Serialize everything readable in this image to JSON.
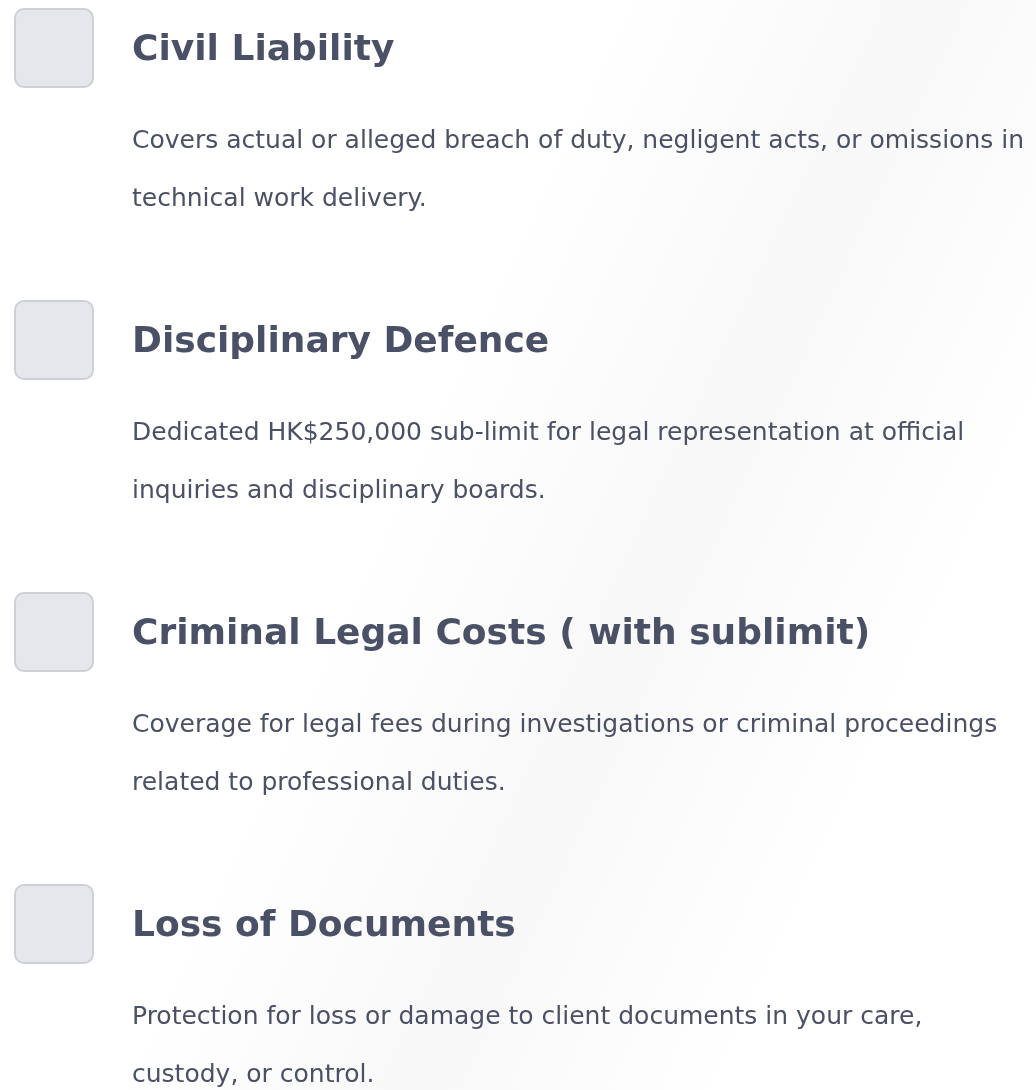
{
  "coverages": [
    {
      "title": "Civil Liability",
      "description": "Covers actual or alleged breach of duty, negligent acts, or omissions in technical work delivery.",
      "checked": false
    },
    {
      "title": "Disciplinary Defence",
      "description": "Dedicated HK$250,000 sub-limit for legal representation at official inquiries and disciplinary boards.",
      "checked": false
    },
    {
      "title": "Criminal Legal Costs ( with sublimit)",
      "description": "Coverage for legal fees during investigations or criminal proceedings related to professional duties.",
      "checked": false
    },
    {
      "title": "Loss of Documents",
      "description": "Protection for loss or damage to client documents in your care, custody, or control.",
      "checked": false
    }
  ]
}
